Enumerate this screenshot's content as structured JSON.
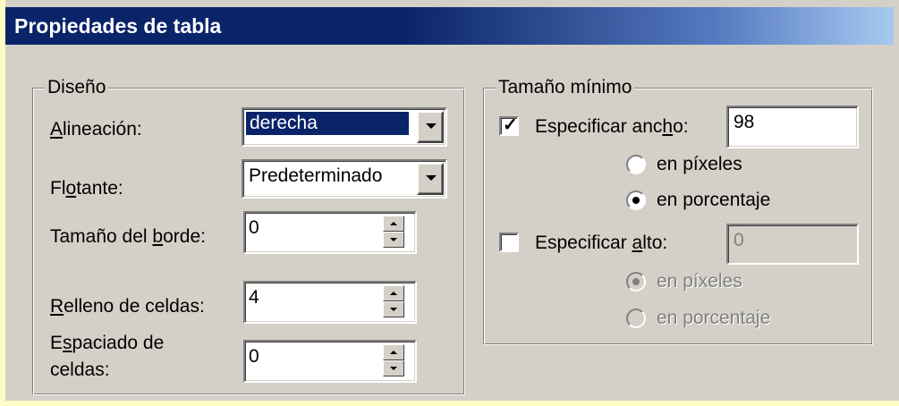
{
  "window": {
    "title": "Propiedades de tabla"
  },
  "colors": {
    "title_bar": "#0a246a",
    "dialog_bg": "#d4d0c8",
    "selection": "#0a246a"
  },
  "layout_group": {
    "title": "Diseño",
    "alignment": {
      "label": "Alineación:",
      "value": "derecha",
      "icon": "chevron-down-icon"
    },
    "floating": {
      "label": "Flotante:",
      "value": "Predeterminado",
      "icon": "chevron-down-icon"
    },
    "border_size": {
      "label": "Tamaño del borde:",
      "value": "0"
    },
    "cell_padding": {
      "label": "Relleno de celdas:",
      "value": "4"
    },
    "cell_spacing": {
      "label_line1": "Espaciado de",
      "label_line2": "celdas:",
      "value": "0"
    }
  },
  "min_size_group": {
    "title": "Tamaño mínimo",
    "width": {
      "checkbox_label": "Especificar ancho:",
      "checked": true,
      "value": "98",
      "unit_pixels": "en píxeles",
      "unit_percent": "en porcentaje",
      "selected_unit": "percent"
    },
    "height": {
      "checkbox_label": "Especificar alto:",
      "checked": false,
      "value": "0",
      "unit_pixels": "en píxeles",
      "unit_percent": "en porcentaje",
      "selected_unit": "pixels",
      "enabled": false
    }
  }
}
